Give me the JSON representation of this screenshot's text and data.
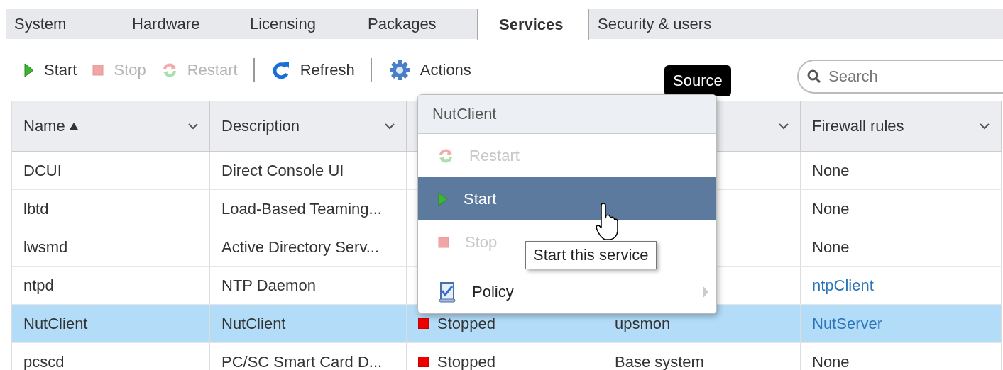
{
  "tabs": [
    {
      "label": "System",
      "selected": false
    },
    {
      "label": "Hardware",
      "selected": false
    },
    {
      "label": "Licensing",
      "selected": false
    },
    {
      "label": "Packages",
      "selected": false
    },
    {
      "label": "Services",
      "selected": true
    },
    {
      "label": "Security & users",
      "selected": false
    }
  ],
  "toolbar": [
    {
      "kind": "start",
      "label": "Start",
      "disabled": false
    },
    {
      "kind": "stop",
      "label": "Stop",
      "disabled": true
    },
    {
      "kind": "restart",
      "label": "Restart",
      "disabled": true
    },
    {
      "kind": "separator"
    },
    {
      "kind": "refresh",
      "label": "Refresh",
      "disabled": false
    },
    {
      "kind": "separator"
    },
    {
      "kind": "actions",
      "label": "Actions",
      "disabled": false
    }
  ],
  "search": {
    "placeholder": "Search"
  },
  "source_tooltip": "Source",
  "table": {
    "columns": [
      {
        "label": "Name",
        "sorted": true,
        "chevron": true
      },
      {
        "label": "Description",
        "sorted": false,
        "chevron": true
      },
      {},
      {
        "sorted": false,
        "chevron": true
      },
      {
        "label": "Firewall rules",
        "sorted": false,
        "chevron": true
      }
    ],
    "rows": [
      {
        "name": "DCUI",
        "description": "Direct Console UI",
        "firewall": "None",
        "link": false,
        "selected": false
      },
      {
        "name": "lbtd",
        "description": "Load-Based Teaming...",
        "firewall": "None",
        "link": false,
        "selected": false
      },
      {
        "name": "lwsmd",
        "description": "Active Directory Serv...",
        "firewall": "None",
        "link": false,
        "selected": false
      },
      {
        "name": "ntpd",
        "description": "NTP Daemon",
        "firewall": "ntpClient",
        "link": true,
        "selected": false
      },
      {
        "name": "NutClient",
        "description": "NutClient",
        "status": "Stopped",
        "source": "upsmon",
        "firewall": "NutServer",
        "link": true,
        "selected": true
      },
      {
        "name": "pcscd",
        "description": "PC/SC Smart Card D...",
        "status": "Stopped",
        "source": "Base system",
        "firewall": "None",
        "link": false,
        "selected": false
      }
    ]
  },
  "menu": {
    "title": "NutClient",
    "items": [
      {
        "kind": "restart",
        "label": "Restart",
        "disabled": true,
        "selected": false,
        "submenu": false
      },
      {
        "kind": "start",
        "label": "Start",
        "disabled": false,
        "selected": true,
        "submenu": false
      },
      {
        "kind": "stop",
        "label": "Stop",
        "disabled": true,
        "selected": false,
        "submenu": false
      },
      {
        "kind": "separator"
      },
      {
        "kind": "policy",
        "label": "Policy",
        "disabled": false,
        "selected": false,
        "submenu": true
      }
    ]
  },
  "hover_tooltip": "Start this service"
}
